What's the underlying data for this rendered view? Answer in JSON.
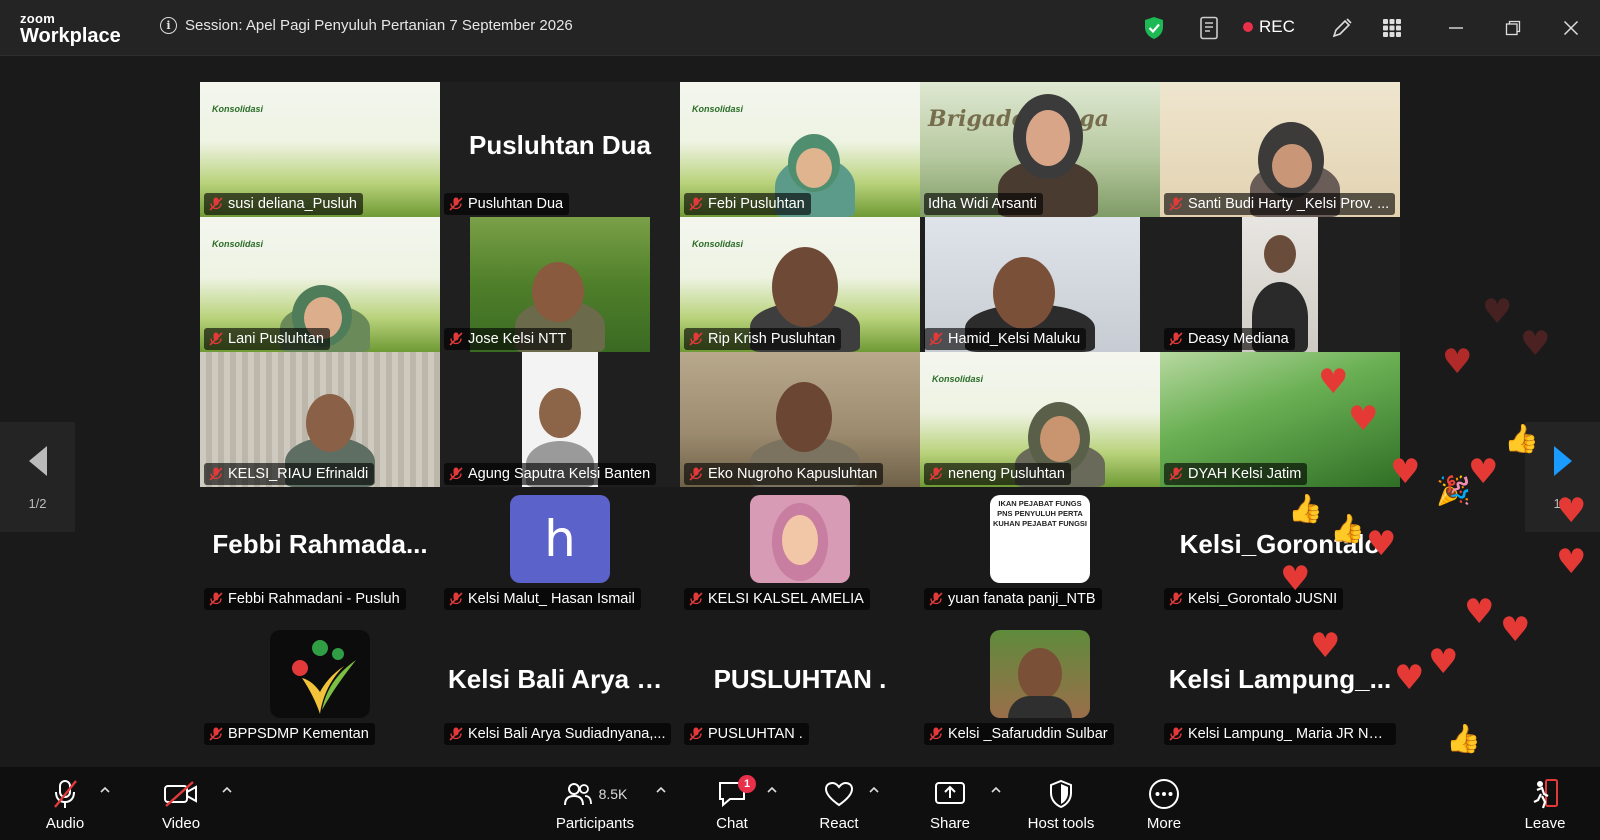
{
  "app": {
    "brand_top": "zoom",
    "brand_bottom": "Workplace"
  },
  "session": {
    "title": "Session: Apel Pagi Penyuluh Pertanian 7 September 2026"
  },
  "titlebar": {
    "rec_label": "REC"
  },
  "pager": {
    "left_label": "1/2",
    "right_label": "1/2"
  },
  "video_tiles": [
    {
      "name": "susi deliana_Pusluh"
    },
    {
      "name": "Pusluhtan Dua",
      "display_name": "Pusluhtan Dua"
    },
    {
      "name": "Febi Pusluhtan"
    },
    {
      "name": "Idha Widi Arsanti"
    },
    {
      "name": "Santi Budi Harty _Kelsi Prov. ..."
    },
    {
      "name": "Lani Pusluhtan"
    },
    {
      "name": "Jose Kelsi NTT"
    },
    {
      "name": "Rip Krish Pusluhtan"
    },
    {
      "name": "Hamid_Kelsi Maluku"
    },
    {
      "name": "Deasy Mediana"
    },
    {
      "name": "KELSI_RIAU Efrinaldi"
    },
    {
      "name": "Agung Saputra Kelsi Banten"
    },
    {
      "name": "Eko Nugroho Kapusluhtan"
    },
    {
      "name": "neneng Pusluhtan"
    },
    {
      "name": "DYAH Kelsi Jatim"
    }
  ],
  "avatar_tiles": [
    {
      "name": "Febbi Rahmadani - Pusluh",
      "display_name": "Febbi  Rahmada..."
    },
    {
      "name": "Kelsi Malut_ Hasan Ismail",
      "avatar_letter": "h"
    },
    {
      "name": "KELSI KALSEL AMELIA"
    },
    {
      "name": "yuan fanata panji_NTB",
      "banner_lines": [
        "IKAN PEJABAT FUNGS",
        "PNS PENYULUH PERTA",
        "KUHAN PEJABAT FUNGSI"
      ]
    },
    {
      "name": "Kelsi_Gorontalo JUSNI",
      "display_name": "Kelsi_Gorontalo"
    },
    {
      "name": "BPPSDMP Kementan"
    },
    {
      "name": "Kelsi Bali Arya Sudiadnyana,...",
      "display_name": "Kelsi  Bali Arya S..."
    },
    {
      "name": "PUSLUHTAN .",
      "display_name": "PUSLUHTAN ."
    },
    {
      "name": "Kelsi _Safaruddin Sulbar"
    },
    {
      "name": "Kelsi Lampung_ Maria JR Nai...",
      "display_name": "Kelsi  Lampung_..."
    }
  ],
  "scene_text": {
    "konsolidasi": "Konsolidasi",
    "brigade": "Brigade Panga"
  },
  "toolbar": {
    "audio": "Audio",
    "video": "Video",
    "participants": "Participants",
    "participants_count": "8.5K",
    "chat": "Chat",
    "chat_badge": "1",
    "react": "React",
    "share": "Share",
    "host_tools": "Host tools",
    "more": "More",
    "leave": "Leave"
  },
  "colors": {
    "active_speaker": "#2fd66b",
    "rec": "#e8304a",
    "shield": "#1db954",
    "avatar_h": "#5b62c9",
    "reaction_heart": "#e53935",
    "pager_arrow": "#1a9bff"
  }
}
